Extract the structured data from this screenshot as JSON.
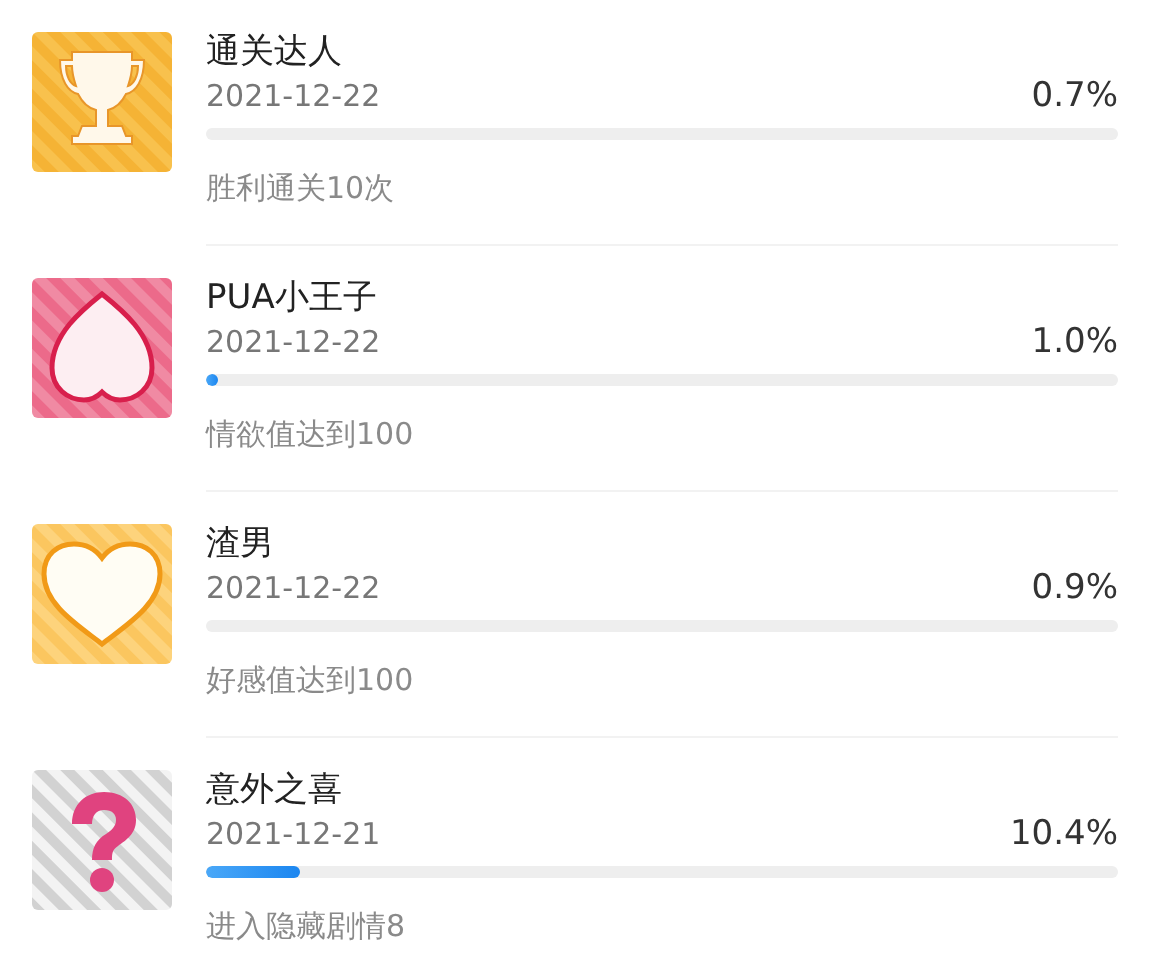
{
  "achievements": [
    {
      "kind": "trophy",
      "title": "通关达人",
      "date": "2021-12-22",
      "percent": "0.7%",
      "description": "胜利通关10次"
    },
    {
      "kind": "peach",
      "title": "PUA小王子",
      "date": "2021-12-22",
      "percent": "1.0%",
      "level": 0.01,
      "description": "情欲值达到100"
    },
    {
      "kind": "heart",
      "title": "渣男",
      "date": "2021-12-22",
      "percent": "0.9%",
      "description": "好感值达到100"
    },
    {
      "kind": "question",
      "title": "意外之喜",
      "date": "2021-12-21",
      "percent": "10.4%",
      "level": 0.104,
      "description": "进入隐藏剧情8"
    }
  ]
}
